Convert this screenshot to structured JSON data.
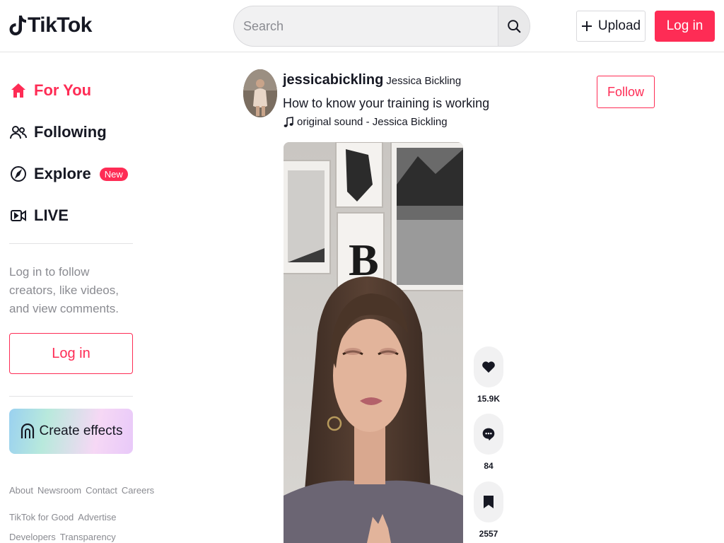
{
  "header": {
    "logo_text": "TikTok",
    "search_placeholder": "Search",
    "upload_label": "Upload",
    "login_label": "Log in"
  },
  "sidebar": {
    "nav": [
      {
        "label": "For You",
        "icon": "home-icon",
        "active": true
      },
      {
        "label": "Following",
        "icon": "users-icon",
        "active": false
      },
      {
        "label": "Explore",
        "icon": "compass-icon",
        "active": false,
        "badge": "New"
      },
      {
        "label": "LIVE",
        "icon": "live-video-icon",
        "active": false
      }
    ],
    "login_hint": "Log in to follow creators, like videos, and view comments.",
    "login_label": "Log in",
    "create_effects_label": "Create effects",
    "footer_links": [
      [
        "About",
        "Newsroom",
        "Contact",
        "Careers"
      ],
      [
        "TikTok for Good",
        "Advertise"
      ],
      [
        "Developers",
        "Transparency"
      ]
    ]
  },
  "post": {
    "username": "jessicabickling",
    "nickname": "Jessica Bickling",
    "caption": "How to know your training is working",
    "sound": "original sound - Jessica Bickling",
    "follow_label": "Follow",
    "actions": {
      "likes": "15.9K",
      "comments": "84",
      "saves": "2557"
    }
  },
  "colors": {
    "accent": "#fe2c55",
    "text": "#161823",
    "muted": "#8a8b91"
  }
}
